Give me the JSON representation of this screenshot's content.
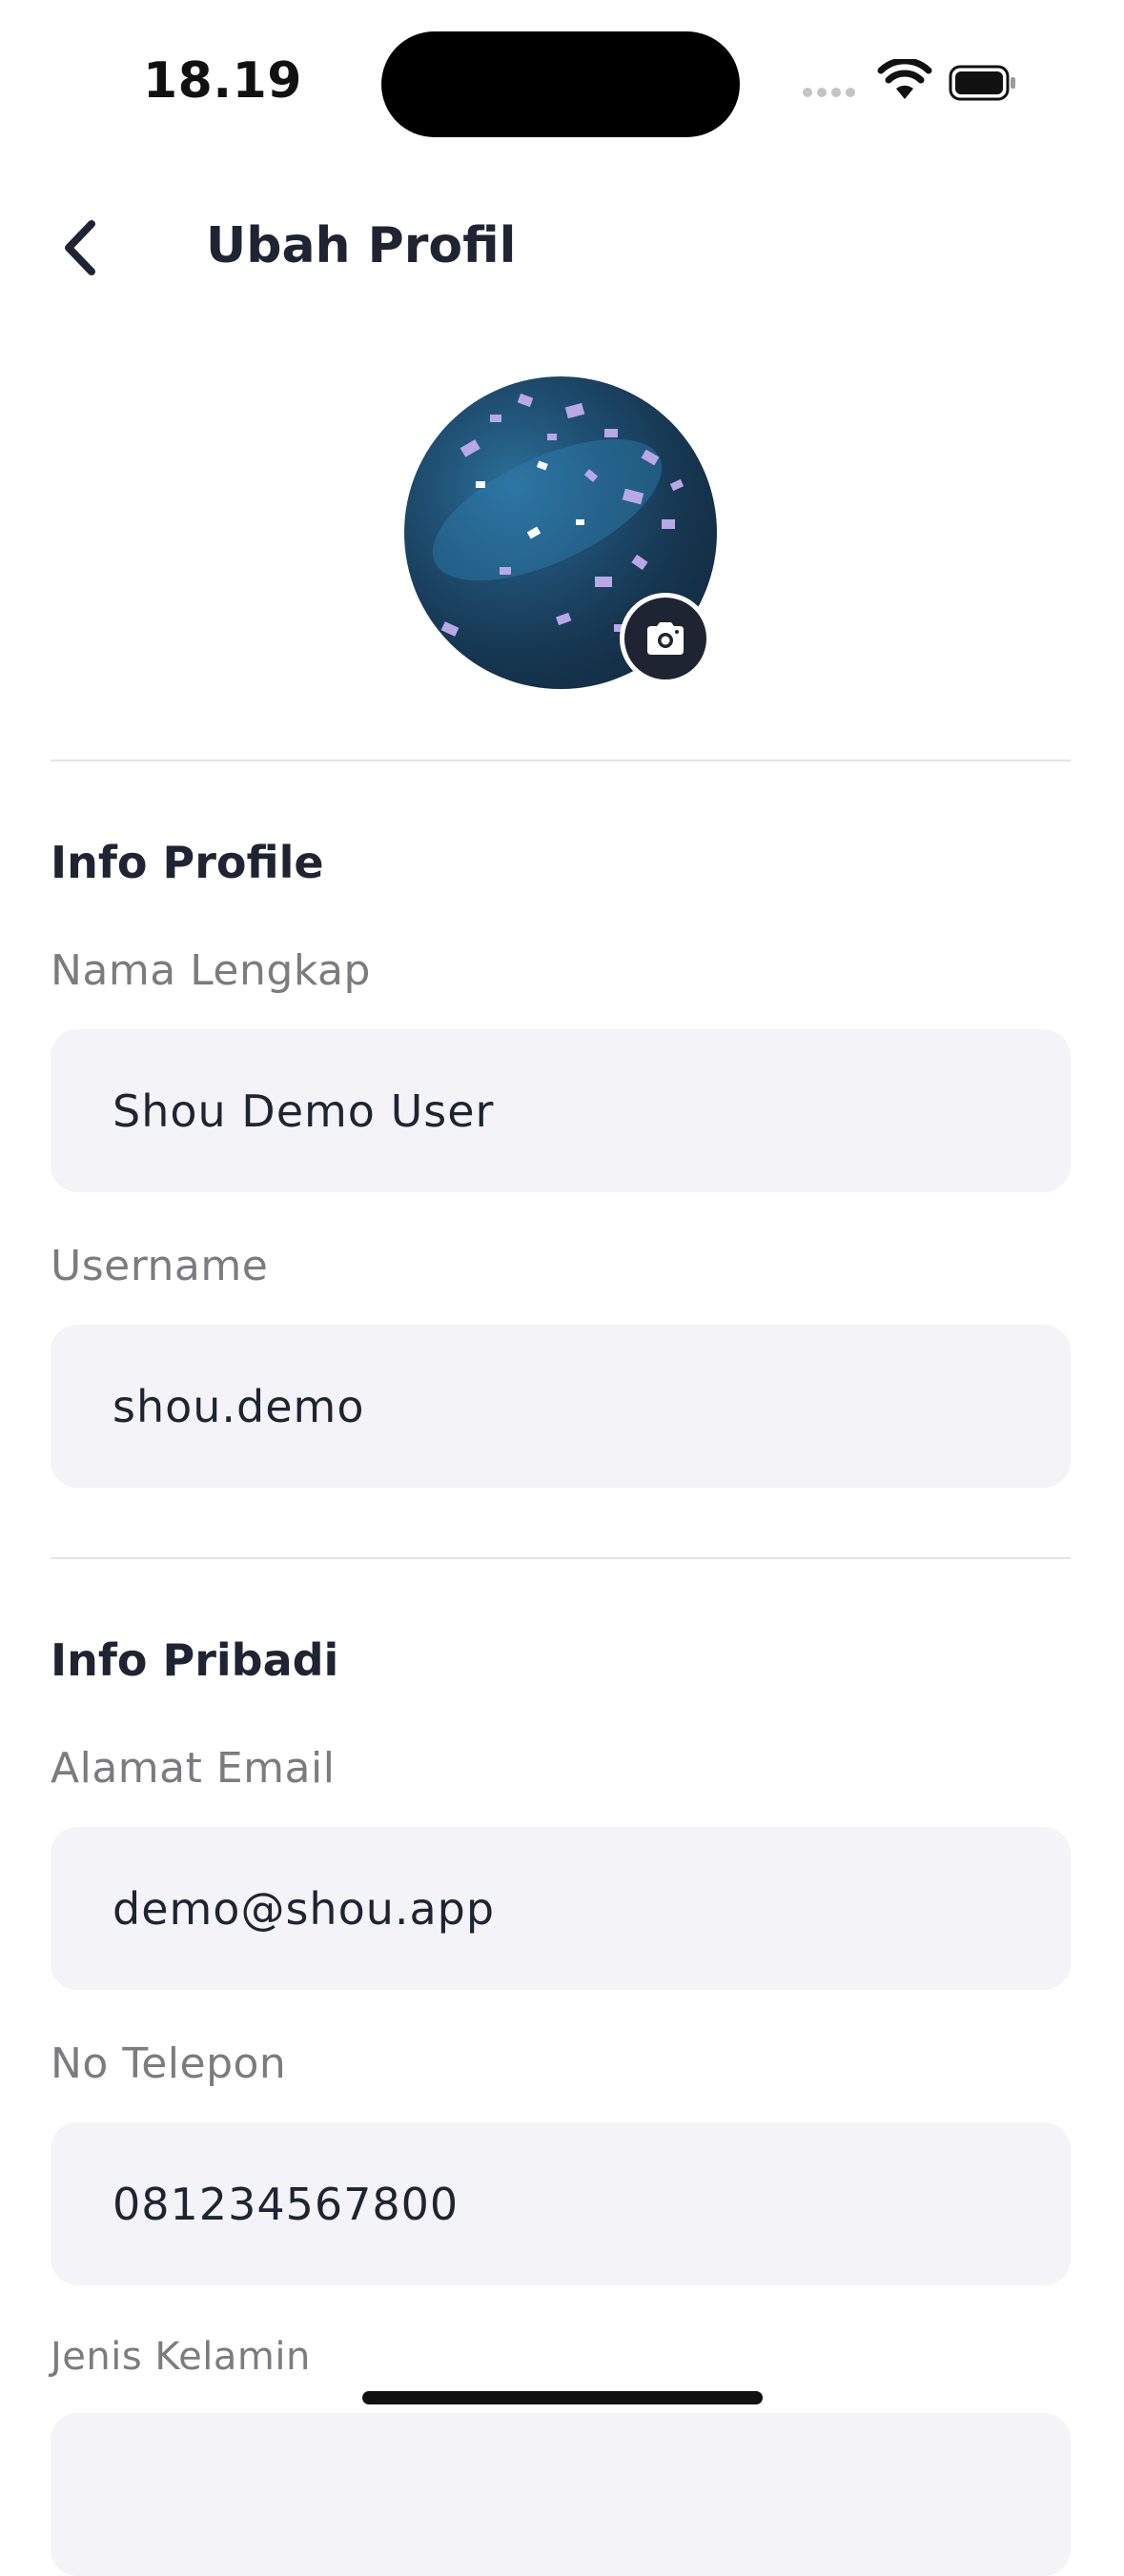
{
  "status_bar": {
    "time": "18.19"
  },
  "header": {
    "title": "Ubah Profil"
  },
  "profile_info": {
    "section_title": "Info Profile",
    "full_name": {
      "label": "Nama Lengkap",
      "value": "Shou Demo User"
    },
    "username": {
      "label": "Username",
      "value": "shou.demo"
    }
  },
  "personal_info": {
    "section_title": "Info Pribadi",
    "email": {
      "label": "Alamat Email",
      "value": "demo@shou.app"
    },
    "phone": {
      "label": "No Telepon",
      "value": "081234567800"
    },
    "gender": {
      "label": "Jenis Kelamin",
      "value": ""
    }
  },
  "icons": [
    "back-arrow-icon",
    "camera-icon",
    "wifi-icon",
    "battery-icon",
    "signal-icon"
  ],
  "colors": {
    "text_primary": "#1f2433",
    "label_gray": "#7b7b80",
    "field_bg": "#f4f4f8"
  }
}
